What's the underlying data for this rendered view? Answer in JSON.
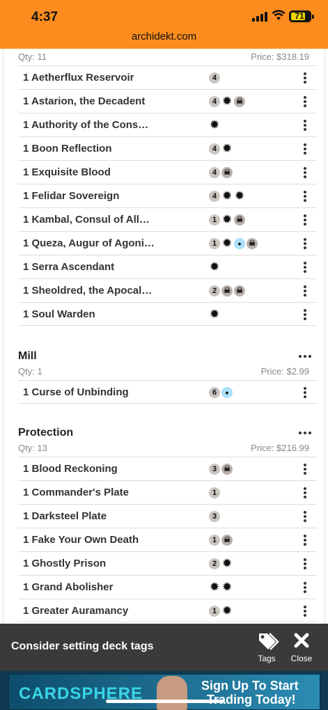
{
  "status_bar": {
    "time": "4:37",
    "battery": "71"
  },
  "browser": {
    "url": "archidekt.com"
  },
  "sections": [
    {
      "qty": "Qty: 11",
      "price": "Price: $318.19",
      "cards": [
        {
          "name": "1 Aetherflux Reservoir",
          "mana": [
            "4"
          ]
        },
        {
          "name": "1 Astarion, the Decadent",
          "mana": [
            "4",
            "W",
            "B"
          ]
        },
        {
          "name": "1 Authority of the Cons…",
          "mana": [
            "W"
          ]
        },
        {
          "name": "1 Boon Reflection",
          "mana": [
            "4",
            "W"
          ]
        },
        {
          "name": "1 Exquisite Blood",
          "mana": [
            "4",
            "B"
          ]
        },
        {
          "name": "1 Felidar Sovereign",
          "mana": [
            "4",
            "W",
            "W"
          ]
        },
        {
          "name": "1 Kambal, Consul of All…",
          "mana": [
            "1",
            "W",
            "B"
          ]
        },
        {
          "name": "1 Queza, Augur of Agoni…",
          "mana": [
            "1",
            "W",
            "U",
            "B"
          ]
        },
        {
          "name": "1 Serra Ascendant",
          "mana": [
            "W"
          ]
        },
        {
          "name": "1 Sheoldred, the Apocal…",
          "mana": [
            "2",
            "B",
            "B"
          ]
        },
        {
          "name": "1 Soul Warden",
          "mana": [
            "W"
          ]
        }
      ]
    },
    {
      "title": "Mill",
      "qty": "Qty: 1",
      "price": "Price: $2.99",
      "cards": [
        {
          "name": "1 Curse of Unbinding",
          "mana": [
            "6",
            "U"
          ]
        }
      ]
    },
    {
      "title": "Protection",
      "qty": "Qty: 13",
      "price": "Price: $216.99",
      "cards": [
        {
          "name": "1 Blood Reckoning",
          "mana": [
            "3",
            "B"
          ]
        },
        {
          "name": "1 Commander's Plate",
          "mana": [
            "1"
          ]
        },
        {
          "name": "1 Darksteel Plate",
          "mana": [
            "3"
          ]
        },
        {
          "name": "1 Fake Your Own Death",
          "mana": [
            "1",
            "B"
          ]
        },
        {
          "name": "1 Ghostly Prison",
          "mana": [
            "2",
            "W"
          ]
        },
        {
          "name": "1 Grand Abolisher",
          "mana": [
            "W",
            "W"
          ]
        },
        {
          "name": "1 Greater Auramancy",
          "mana": [
            "1",
            "W"
          ]
        }
      ]
    }
  ],
  "tag_prompt": {
    "text": "Consider setting deck tags",
    "tags_label": "Tags",
    "close_label": "Close"
  },
  "ad": {
    "brand": "CARDSPHERE",
    "cta_line1": "Sign Up To Start",
    "cta_line2": "Trading Today!"
  },
  "icons": {
    "more": "ellipsis-vertical-icon",
    "section_more": "ellipsis-horizontal-icon",
    "tags": "tags-icon",
    "close": "close-icon"
  }
}
